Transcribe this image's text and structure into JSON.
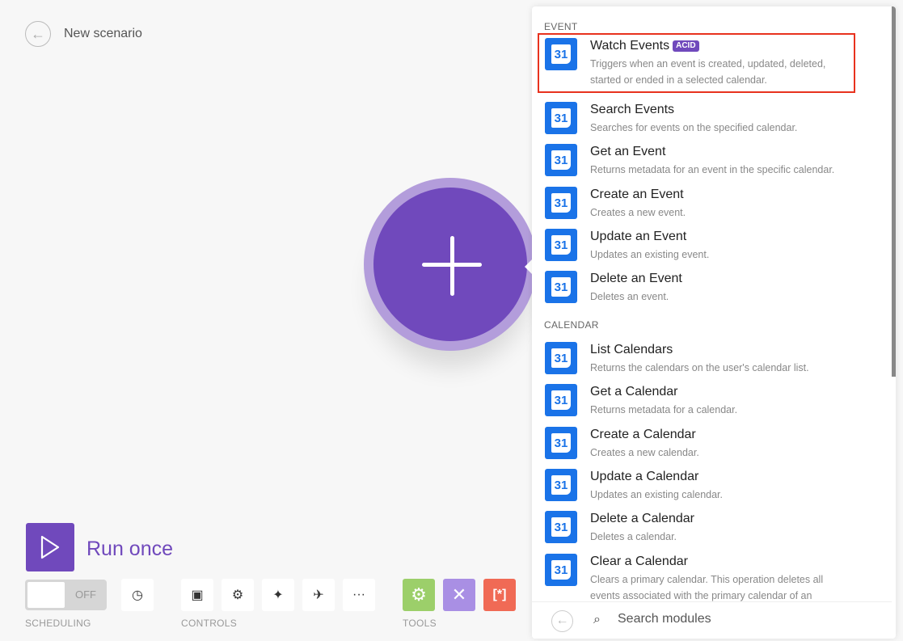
{
  "header": {
    "title": "New scenario"
  },
  "run": {
    "label": "Run once"
  },
  "scheduling": {
    "toggle": "OFF",
    "label": "SCHEDULING"
  },
  "controls": {
    "label": "CONTROLS"
  },
  "tools": {
    "label": "TOOLS",
    "colors": [
      "#9ccf6a",
      "#a98fe4",
      "#f06a55"
    ]
  },
  "panel": {
    "sections": [
      {
        "title": "EVENT",
        "items": [
          {
            "title": "Watch Events",
            "badge": "ACID",
            "desc": "Triggers when an event is created, updated, deleted, started or ended in a selected calendar.",
            "selected": true
          },
          {
            "title": "Search Events",
            "desc": "Searches for events on the specified calendar."
          },
          {
            "title": "Get an Event",
            "desc": "Returns metadata for an event in the specific calendar."
          },
          {
            "title": "Create an Event",
            "desc": "Creates a new event."
          },
          {
            "title": "Update an Event",
            "desc": "Updates an existing event."
          },
          {
            "title": "Delete an Event",
            "desc": "Deletes an event."
          }
        ]
      },
      {
        "title": "CALENDAR",
        "items": [
          {
            "title": "List Calendars",
            "desc": "Returns the calendars on the user's calendar list."
          },
          {
            "title": "Get a Calendar",
            "desc": "Returns metadata for a calendar."
          },
          {
            "title": "Create a Calendar",
            "desc": "Creates a new calendar."
          },
          {
            "title": "Update a Calendar",
            "desc": "Updates an existing calendar."
          },
          {
            "title": "Delete a Calendar",
            "desc": "Deletes a calendar."
          },
          {
            "title": "Clear a Calendar",
            "desc": "Clears a primary calendar. This operation deletes all events associated with the primary calendar of an account."
          }
        ]
      }
    ],
    "icon_text": "31",
    "search_placeholder": "Search modules"
  }
}
